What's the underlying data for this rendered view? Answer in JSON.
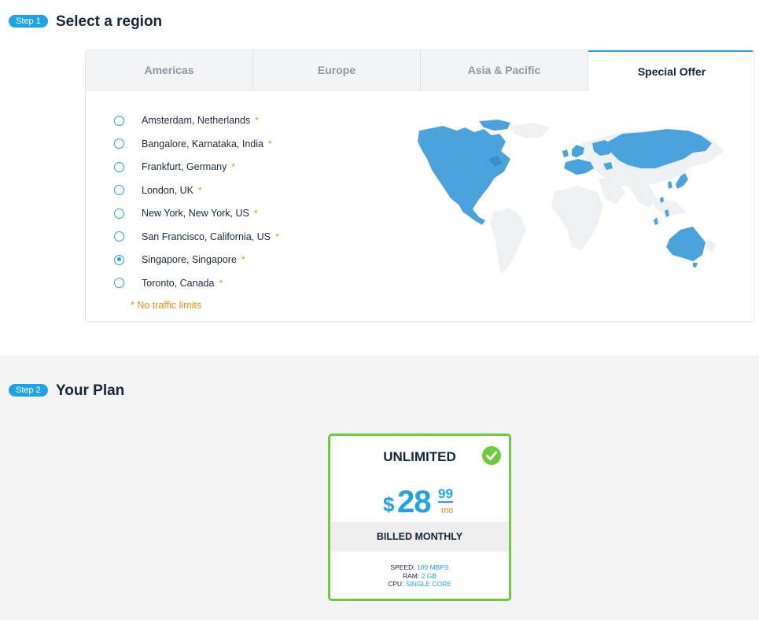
{
  "step1": {
    "badge": "Step 1",
    "title": "Select a region"
  },
  "tabs": [
    {
      "label": "Americas",
      "active": false
    },
    {
      "label": "Europe",
      "active": false
    },
    {
      "label": "Asia & Pacific",
      "active": false
    },
    {
      "label": "Special Offer",
      "active": true
    }
  ],
  "locations": [
    {
      "label": "Amsterdam, Netherlands",
      "star": "*",
      "selected": false
    },
    {
      "label": "Bangalore, Karnataka, India",
      "star": "*",
      "selected": false
    },
    {
      "label": "Frankfurt, Germany",
      "star": "*",
      "selected": false
    },
    {
      "label": "London, UK",
      "star": "*",
      "selected": false
    },
    {
      "label": "New York, New York, US",
      "star": "*",
      "selected": false
    },
    {
      "label": "San Francisco, California, US",
      "star": "*",
      "selected": false
    },
    {
      "label": "Singapore, Singapore",
      "star": "*",
      "selected": true
    },
    {
      "label": "Toronto, Canada",
      "star": "*",
      "selected": false
    }
  ],
  "note": "* No traffic limits",
  "step2": {
    "badge": "Step 2",
    "title": "Your Plan"
  },
  "plan": {
    "name": "UNLIMITED",
    "currency": "$",
    "amount": "28",
    "cents": "99",
    "period": "mo",
    "billing": "BILLED MONTHLY",
    "specs": [
      {
        "label": "SPEED:",
        "value": "100 MBPS"
      },
      {
        "label": "RAM:",
        "value": "2 GB"
      },
      {
        "label": "CPU:",
        "value": "SINGLE CORE"
      }
    ]
  },
  "colors": {
    "accent": "#1ea3e6",
    "selected_border": "#6fcb3d",
    "star": "#f08a12"
  }
}
